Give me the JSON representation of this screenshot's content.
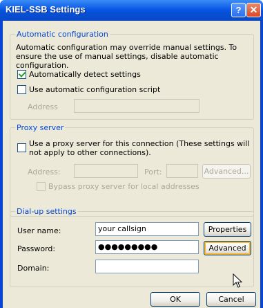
{
  "window": {
    "title": "KIEL-SSB Settings",
    "help_label": "?",
    "close_label": "✕"
  },
  "auto_config": {
    "legend": "Automatic configuration",
    "description": "Automatic configuration may override manual settings.  To ensure the use of manual settings, disable automatic configuration.",
    "detect_label": "Automatically detect settings",
    "detect_checked": true,
    "script_label": "Use automatic configuration script",
    "script_checked": false,
    "address_label": "Address",
    "address_value": ""
  },
  "proxy": {
    "legend": "Proxy server",
    "use_proxy_label": "Use a proxy server for this connection (These settings will not apply to other connections).",
    "use_proxy_checked": false,
    "address_label": "Address:",
    "address_value": "",
    "port_label": "Port:",
    "port_value": "",
    "advanced_label": "Advanced...",
    "bypass_label": "Bypass proxy server for local addresses",
    "bypass_checked": false
  },
  "dialup": {
    "legend": "Dial-up settings",
    "username_label": "User name:",
    "username_value": "your callsign",
    "password_label": "Password:",
    "password_value": "●●●●●●●●●",
    "domain_label": "Domain:",
    "domain_value": "",
    "properties_label": "Properties",
    "advanced_label": "Advanced"
  },
  "footer": {
    "ok_label": "OK",
    "cancel_label": "Cancel"
  },
  "colors": {
    "accent": "#0046d5",
    "titlebar": "#0a58e6",
    "face": "#ece9d8"
  }
}
